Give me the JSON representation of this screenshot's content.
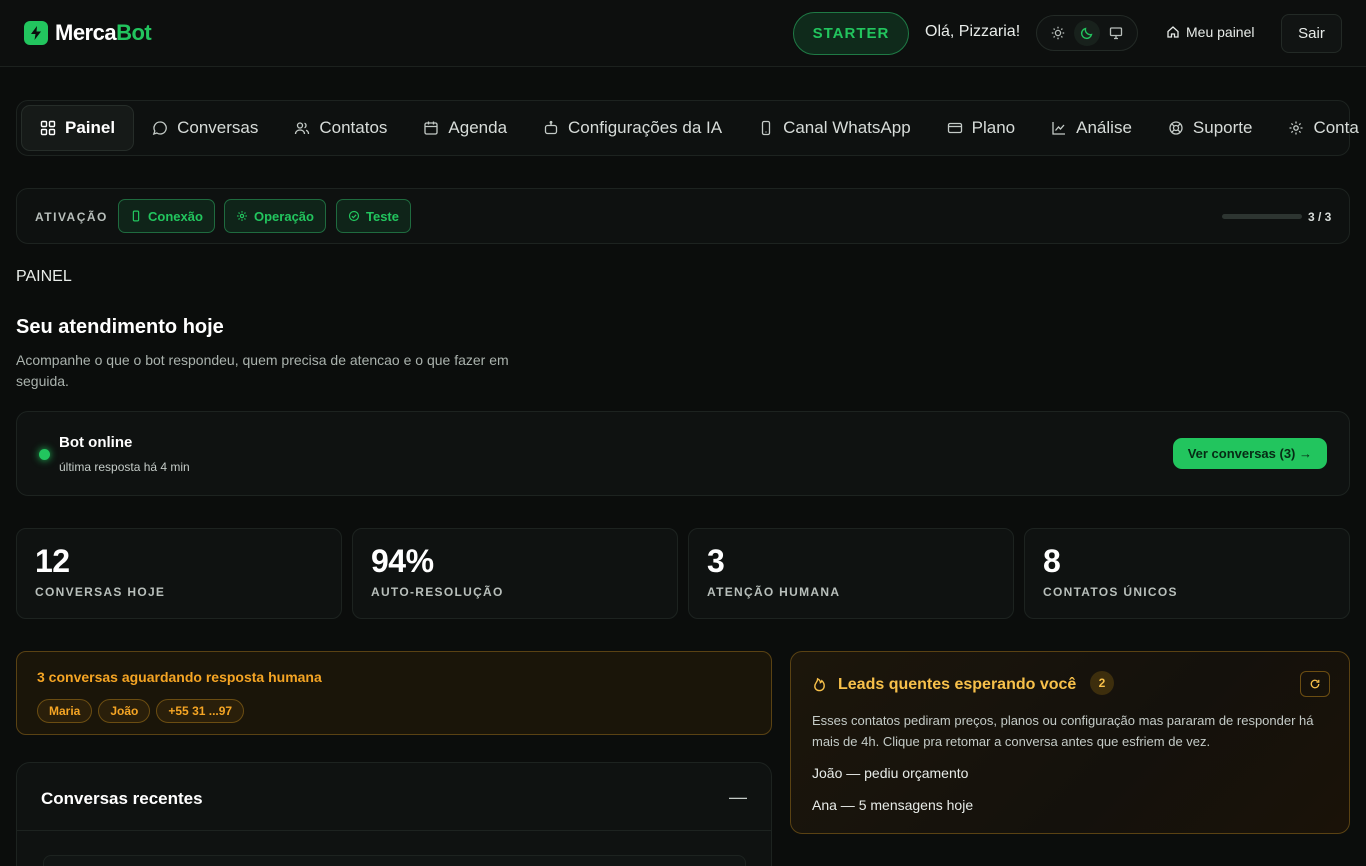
{
  "colors": {
    "accent": "#22c55e",
    "warning": "#f5a524",
    "background": "#0b0d0c"
  },
  "header": {
    "brand_part1": "Merca",
    "brand_part2": "Bot",
    "plan": "STARTER",
    "greeting": "Olá, Pizzaria!",
    "theme_options": [
      "sun-icon",
      "moon-icon",
      "monitor-icon"
    ],
    "theme_selected": "moon-icon",
    "my_panel": "Meu painel",
    "logout": "Sair"
  },
  "nav": {
    "items": [
      {
        "label": "Painel",
        "icon": "grid-icon",
        "active": true
      },
      {
        "label": "Conversas",
        "icon": "chat-bubble-icon"
      },
      {
        "label": "Contatos",
        "icon": "users-icon"
      },
      {
        "label": "Agenda",
        "icon": "calendar-icon"
      },
      {
        "label": "Configurações da IA",
        "icon": "robot-icon"
      },
      {
        "label": "Canal WhatsApp",
        "icon": "smartphone-icon"
      },
      {
        "label": "Plano",
        "icon": "credit-card-icon"
      },
      {
        "label": "Análise",
        "icon": "line-chart-icon"
      },
      {
        "label": "Suporte",
        "icon": "lifebuoy-icon"
      },
      {
        "label": "Conta",
        "icon": "gear-icon"
      }
    ]
  },
  "activation": {
    "label": "ATIVAÇÃO",
    "steps": [
      {
        "label": "Conexão",
        "icon": "smartphone-icon"
      },
      {
        "label": "Operação",
        "icon": "gear-icon"
      },
      {
        "label": "Teste",
        "icon": "check-circle-icon"
      }
    ],
    "progress_fraction": 1.0,
    "progress_text": "3 / 3"
  },
  "page": {
    "section": "PAINEL",
    "title": "Seu atendimento hoje",
    "subtitle": "Acompanhe o que o bot respondeu, quem precisa de atencao e o que fazer em seguida."
  },
  "bot_status": {
    "title": "Bot online",
    "subtitle": "última resposta há 4 min",
    "button": "Ver conversas (3) →"
  },
  "stats": [
    {
      "value": "12",
      "label": "CONVERSAS HOJE"
    },
    {
      "value": "94%",
      "label": "AUTO-RESOLUÇÃO"
    },
    {
      "value": "3",
      "label": "ATENÇÃO HUMANA"
    },
    {
      "value": "8",
      "label": "CONTATOS ÚNICOS"
    }
  ],
  "waiting": {
    "title": "3 conversas aguardando resposta humana",
    "contacts": [
      "Maria",
      "João",
      "+55 31 ...97"
    ]
  },
  "recent": {
    "title": "Conversas recentes",
    "toggle": "—"
  },
  "leads": {
    "title": "Leads quentes esperando você",
    "count": "2",
    "description": "Esses contatos pediram preços, planos ou configuração mas pararam de responder há mais de 4h. Clique pra retomar a conversa antes que esfriem de vez.",
    "items": [
      "João — pediu orçamento",
      "Ana — 5 mensagens hoje"
    ]
  }
}
